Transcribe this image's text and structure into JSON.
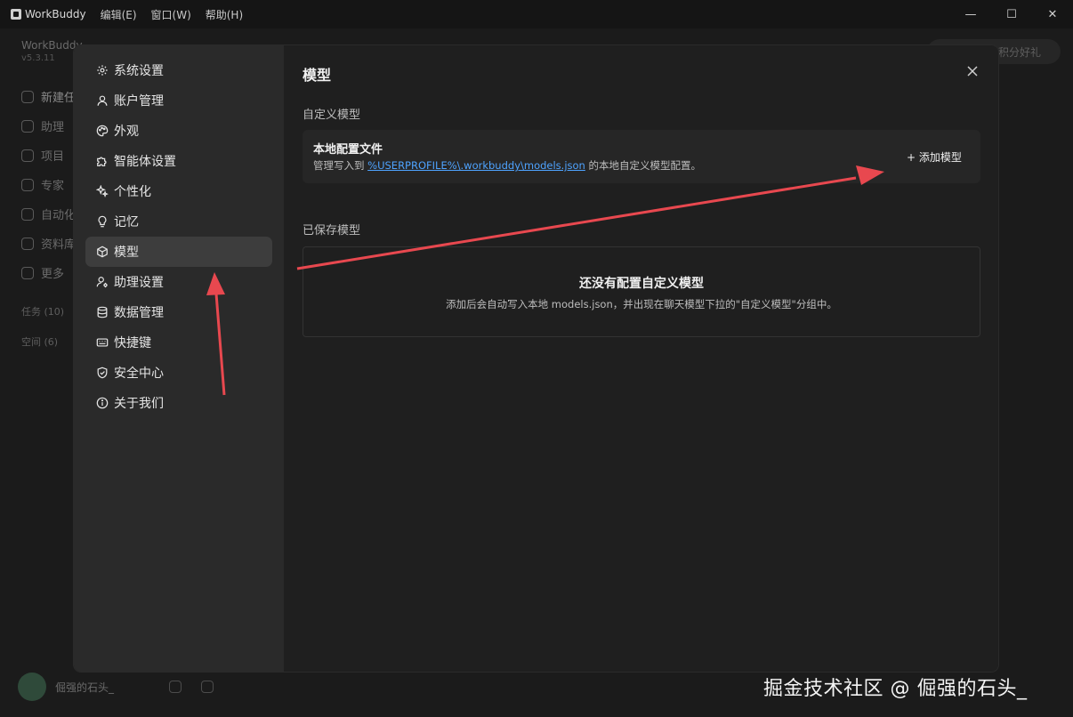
{
  "window": {
    "app_title": "WorkBuddy",
    "menu": [
      "编辑(E)",
      "窗口(W)",
      "帮助(H)"
    ],
    "controls": {
      "minimize": "—",
      "maximize": "☐",
      "close": "✕"
    }
  },
  "background_app": {
    "brand": "WorkBuddy",
    "version": "v5.3.11",
    "nav": [
      "新建任",
      "助理",
      "项目",
      "专家",
      "自动化",
      "资料库",
      "更多"
    ],
    "tasks_label": "任务 (10)",
    "spaces_label": "空间 (6)",
    "promo_pill": "积分好礼",
    "user_name": "倔强的石头_"
  },
  "settings": {
    "sidebar": {
      "items": [
        {
          "label": "系统设置",
          "icon": "gear-icon"
        },
        {
          "label": "账户管理",
          "icon": "user-icon"
        },
        {
          "label": "外观",
          "icon": "palette-icon"
        },
        {
          "label": "智能体设置",
          "icon": "puzzle-icon"
        },
        {
          "label": "个性化",
          "icon": "sparkle-icon"
        },
        {
          "label": "记忆",
          "icon": "lightbulb-icon"
        },
        {
          "label": "模型",
          "icon": "cube-icon"
        },
        {
          "label": "助理设置",
          "icon": "user-gear-icon"
        },
        {
          "label": "数据管理",
          "icon": "database-icon"
        },
        {
          "label": "快捷键",
          "icon": "keyboard-icon"
        },
        {
          "label": "安全中心",
          "icon": "shield-icon"
        },
        {
          "label": "关于我们",
          "icon": "info-icon"
        }
      ],
      "active_index": 6
    },
    "main": {
      "title": "模型",
      "custom_section_label": "自定义模型",
      "local_config": {
        "title": "本地配置文件",
        "desc_prefix": "管理写入到 ",
        "path": "%USERPROFILE%\\.workbuddy\\models.json",
        "desc_suffix": " 的本地自定义模型配置。",
        "add_button": "+ 添加模型"
      },
      "saved_section_label": "已保存模型",
      "empty_state": {
        "title": "还没有配置自定义模型",
        "desc": "添加后会自动写入本地 models.json，并出现在聊天模型下拉的\"自定义模型\"分组中。"
      }
    }
  },
  "annotation": {
    "arrow_color": "#e8484f"
  },
  "watermark": "掘金技术社区 @ 倔强的石头_"
}
